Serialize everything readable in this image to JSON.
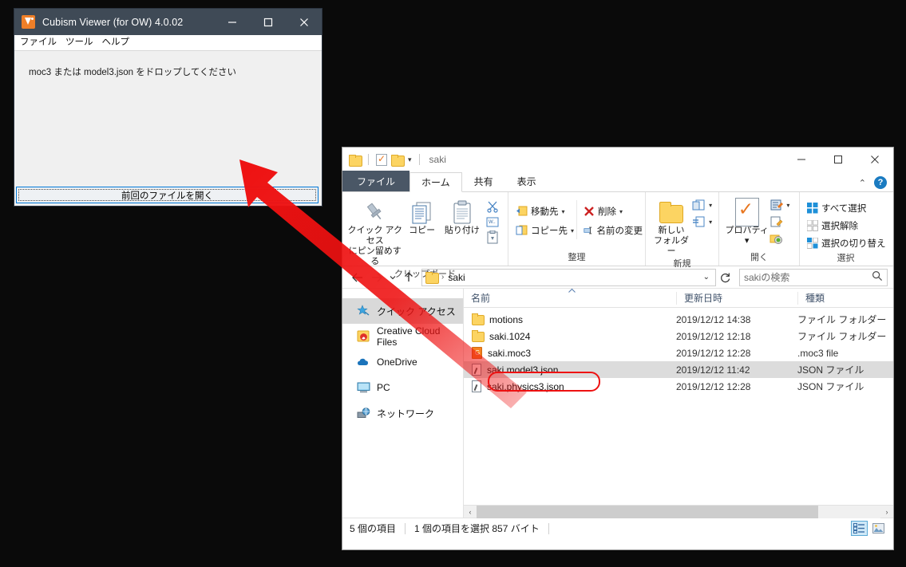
{
  "viewer": {
    "title": "Cubism Viewer (for OW) 4.0.02",
    "app_icon": "cubism-logo-icon",
    "window_buttons": {
      "minimize": "minimize-icon",
      "maximize": "maximize-icon",
      "close": "close-icon"
    },
    "menu": [
      "ファイル",
      "ツール",
      "ヘルプ"
    ],
    "drop_text": "moc3 または model3.json をドロップしてください",
    "open_previous_button": "前回のファイルを開く"
  },
  "explorer": {
    "title": "saki",
    "quick_access_toolbar": [
      "folder-icon",
      "properties-icon",
      "new-folder-icon",
      "customize-caret-icon"
    ],
    "window_buttons": {
      "minimize": "minimize-icon",
      "maximize": "maximize-icon",
      "close": "close-icon"
    },
    "help": {
      "collapse": "chevron-up-icon",
      "help": "?"
    },
    "tabs": [
      {
        "label": "ファイル",
        "active": false,
        "kind": "file"
      },
      {
        "label": "ホーム",
        "active": true,
        "kind": "normal"
      },
      {
        "label": "共有",
        "active": false,
        "kind": "normal"
      },
      {
        "label": "表示",
        "active": false,
        "kind": "normal"
      }
    ],
    "ribbon": {
      "groups": [
        {
          "label": "クリップボード",
          "big_buttons": [
            {
              "label": "クイック アクセス\nにピン留めする",
              "icon": "pin-icon"
            },
            {
              "label": "コピー",
              "icon": "copy-icon"
            },
            {
              "label": "貼り付け",
              "icon": "paste-icon"
            }
          ],
          "small_buttons": [
            {
              "label": "",
              "icon": "cut-scissors-icon"
            },
            {
              "label": "",
              "icon": "copy-path-icon"
            },
            {
              "label": "",
              "icon": "paste-shortcut-icon"
            }
          ]
        },
        {
          "label": "整理",
          "small_buttons": [
            {
              "label": "移動先",
              "icon": "move-to-icon",
              "caret": "▾"
            },
            {
              "label": "削除",
              "icon": "delete-x-icon",
              "caret": "▾"
            },
            {
              "label": "コピー先",
              "icon": "copy-to-icon",
              "caret": "▾"
            },
            {
              "label": "名前の変更",
              "icon": "rename-icon",
              "caret": ""
            }
          ]
        },
        {
          "label": "新規",
          "big_buttons": [
            {
              "label": "新しい\nフォルダー",
              "icon": "new-folder-icon"
            }
          ],
          "small_buttons": [
            {
              "label": "",
              "icon": "new-item-icon",
              "caret": "▾"
            },
            {
              "label": "",
              "icon": "easy-access-icon",
              "caret": "▾"
            }
          ]
        },
        {
          "label": "開く",
          "big_buttons": [
            {
              "label": "プロパティ",
              "icon": "properties-icon",
              "caret": "▾"
            }
          ],
          "small_buttons": [
            {
              "label": "",
              "icon": "open-icon",
              "caret": "▾"
            },
            {
              "label": "",
              "icon": "edit-icon",
              "caret": ""
            },
            {
              "label": "",
              "icon": "history-icon",
              "caret": ""
            }
          ]
        },
        {
          "label": "選択",
          "small_buttons": [
            {
              "label": "すべて選択",
              "icon": "select-all-icon"
            },
            {
              "label": "選択解除",
              "icon": "select-none-icon"
            },
            {
              "label": "選択の切り替え",
              "icon": "invert-selection-icon"
            }
          ]
        }
      ]
    },
    "address_bar": {
      "back": "back-arrow-icon",
      "forward": "forward-arrow-icon",
      "recent": "chevron-down-icon",
      "up": "up-arrow-icon",
      "path_icon": "folder-icon",
      "path": "saki",
      "separator": "›",
      "dropdown": "chevron-down-icon",
      "refresh": "refresh-icon"
    },
    "search": {
      "placeholder": "sakiの検索",
      "icon": "search-icon"
    },
    "nav_pane": [
      {
        "label": "クイック アクセス",
        "icon": "star-pin-icon",
        "selected": true
      },
      {
        "label": "Creative Cloud Files",
        "icon": "creative-cloud-icon",
        "selected": false
      },
      {
        "label": "OneDrive",
        "icon": "onedrive-cloud-icon",
        "selected": false
      },
      {
        "label": "PC",
        "icon": "this-pc-icon",
        "selected": false
      },
      {
        "label": "ネットワーク",
        "icon": "network-icon",
        "selected": false
      }
    ],
    "columns": [
      {
        "label": "名前",
        "sort": "asc"
      },
      {
        "label": "更新日時",
        "sort": ""
      },
      {
        "label": "種類",
        "sort": ""
      }
    ],
    "files": [
      {
        "name": "motions",
        "modified": "2019/12/12 14:38",
        "type": "ファイル フォルダー",
        "icon": "folder",
        "selected": false
      },
      {
        "name": "saki.1024",
        "modified": "2019/12/12 12:18",
        "type": "ファイル フォルダー",
        "icon": "folder",
        "selected": false
      },
      {
        "name": "saki.moc3",
        "modified": "2019/12/12 12:28",
        "type": ".moc3 file",
        "icon": "moc3",
        "selected": false
      },
      {
        "name": "saki.model3.json",
        "modified": "2019/12/12 11:42",
        "type": "JSON ファイル",
        "icon": "json",
        "selected": true
      },
      {
        "name": "saki.physics3.json",
        "modified": "2019/12/12 12:28",
        "type": "JSON ファイル",
        "icon": "json",
        "selected": false
      }
    ],
    "status": {
      "item_count": "5 個の項目",
      "selection": "1 個の項目を選択  857 バイト"
    },
    "view_buttons": [
      {
        "name": "details-view-icon",
        "active": true
      },
      {
        "name": "large-icons-view-icon",
        "active": false
      }
    ],
    "scrollbar": {
      "left_arrow": "‹",
      "right_arrow": "›"
    }
  },
  "annotation": {
    "arrow_color": "#ee1111",
    "highlight_color": "#ee1111",
    "description": "drag-arrow-from-file-to-viewer"
  }
}
